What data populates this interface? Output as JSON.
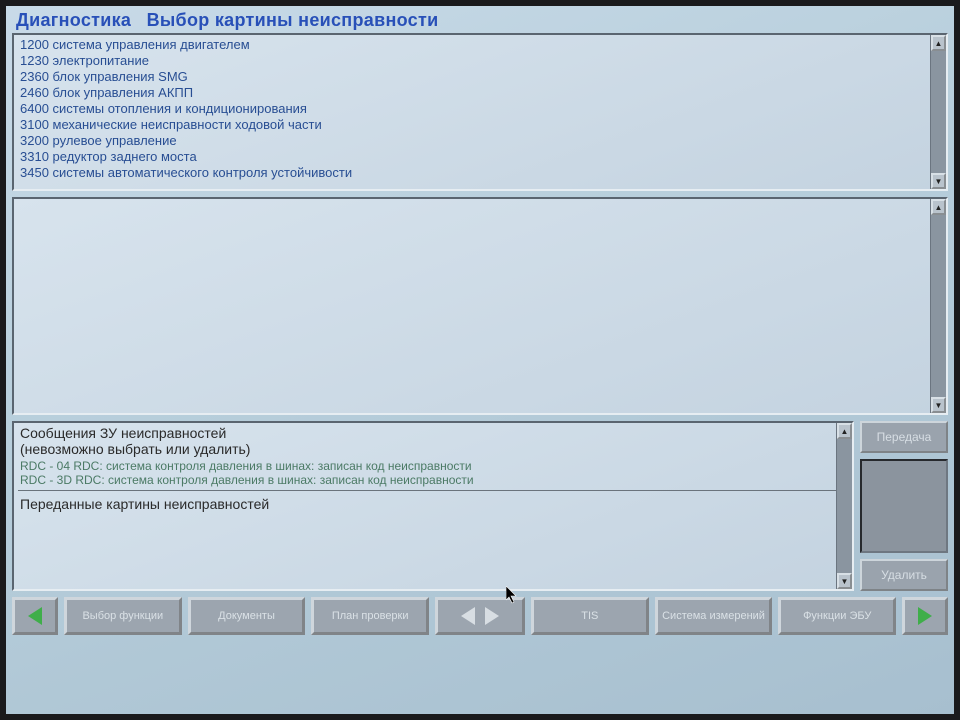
{
  "title": {
    "main": "Диагностика",
    "sub": "Выбор картины неисправности"
  },
  "systems": [
    {
      "code": "1200",
      "name": "система управления двигателем"
    },
    {
      "code": "1230",
      "name": "электропитание"
    },
    {
      "code": "2360",
      "name": "блок управления SMG"
    },
    {
      "code": "2460",
      "name": "блок управления АКПП"
    },
    {
      "code": "6400",
      "name": "системы отопления и кондиционирования"
    },
    {
      "code": "3100",
      "name": "механические неисправности ходовой части"
    },
    {
      "code": "3200",
      "name": "рулевое управление"
    },
    {
      "code": "3310",
      "name": "редуктор заднего моста"
    },
    {
      "code": "3450",
      "name": "системы автоматического контроля устойчивости"
    }
  ],
  "messages": {
    "header": "Сообщения ЗУ неисправностей",
    "subheader": "(невозможно выбрать или удалить)",
    "lines": [
      "RDC - 04 RDC: система контроля давления в шинах: записан код неисправности",
      "RDC - 3D RDC: система контроля давления в шинах: записан код неисправности"
    ],
    "transmitted_header": "Переданные картины неисправностей"
  },
  "side_buttons": {
    "transmit": "Передача",
    "delete": "Удалить"
  },
  "toolbar": {
    "select_function": "Выбор функции",
    "documents": "Документы",
    "test_plan": "План проверки",
    "tis": "TIS",
    "measurement_system": "Система измерений",
    "ecu_functions": "Функции ЭБУ"
  }
}
